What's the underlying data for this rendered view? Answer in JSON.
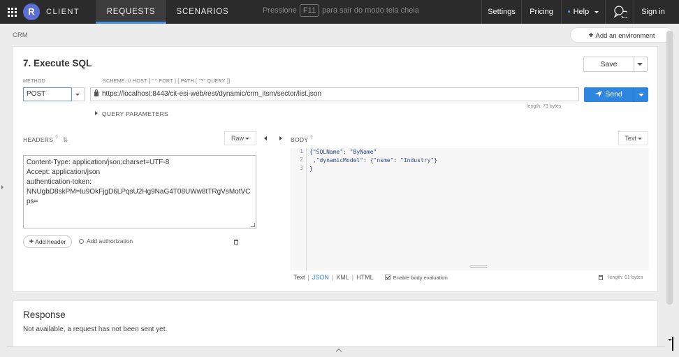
{
  "topbar": {
    "logo_letter": "R",
    "app_name": "CLIENT",
    "tabs": [
      {
        "label": "REQUESTS",
        "active": true
      },
      {
        "label": "SCENARIOS",
        "active": false
      }
    ],
    "fullscreen_hint": {
      "before": "Pressione",
      "key": "F11",
      "after": "para sair do modo tela cheia"
    },
    "settings": "Settings",
    "pricing": "Pricing",
    "help": "Help",
    "signin": "Sign in"
  },
  "breadcrumb": "CRM",
  "add_environment": "Add an environment",
  "request": {
    "title": "7. Execute SQL",
    "save_label": "Save",
    "method_label": "METHOD",
    "method": "POST",
    "url_label": "SCHEME :// HOST [ \":\" PORT ] [ PATH [ \"?\" QUERY ]]",
    "url": "https://localhost:8443/cit-esi-web/rest/dynamic/crm_itsm/sector/list.json",
    "send_label": "Send",
    "length": "length: 73 bytes",
    "query_params": "QUERY PARAMETERS"
  },
  "headers": {
    "title": "HEADERS",
    "mode": "Raw",
    "lines": [
      "Content-Type: application/json;charset=UTF-8",
      "Accept: application/json",
      "authentication-token:",
      "NNUgbD8skPM=Iu9OkFjgD6LPqsU2Hg9NaG4T08UWw8tTRgVsMotVC",
      "ps="
    ],
    "add_header": "Add header",
    "add_authorization": "Add authorization"
  },
  "body": {
    "title": "BODY",
    "mode": "Text",
    "line_numbers": [
      "1",
      "2",
      "3"
    ],
    "code_lines": [
      "{\"SQLName\": \"ByName\"",
      " ,\"dynamicModel\": {\"nsme\": \"Industry\"}",
      "}"
    ],
    "formats": [
      "Text",
      "JSON",
      "XML",
      "HTML"
    ],
    "active_format": "JSON",
    "enable_eval": "Enable body evaluation",
    "length": "length: 61 bytes"
  },
  "response": {
    "title": "Response",
    "message": "Not available, a request has not been sent yet."
  },
  "colors": {
    "topbar": "#2b2b2b",
    "accent": "#2f86de",
    "logo": "#5b6fd6"
  }
}
